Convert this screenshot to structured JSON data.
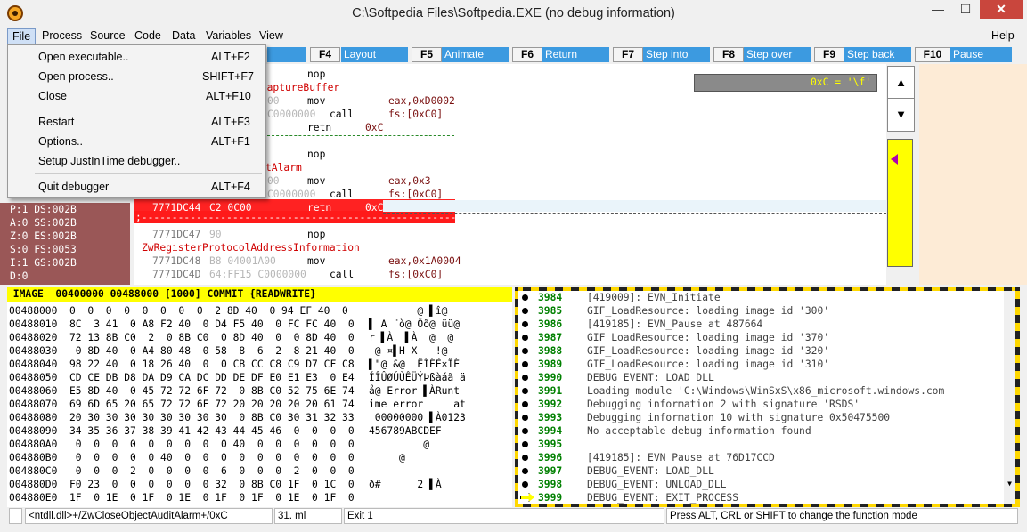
{
  "window": {
    "title": "C:\\Softpedia Files\\Softpedia.EXE (no debug information)",
    "min": "—",
    "max": "☐",
    "close": "✕"
  },
  "menubar": {
    "items": [
      "File",
      "Process",
      "Source",
      "Code",
      "Data",
      "Variables",
      "View"
    ],
    "help": "Help"
  },
  "fkeys": [
    {
      "key": "F4",
      "label": "Layout"
    },
    {
      "key": "F5",
      "label": "Animate"
    },
    {
      "key": "F6",
      "label": "Return"
    },
    {
      "key": "F7",
      "label": "Step into"
    },
    {
      "key": "F8",
      "label": "Step over"
    },
    {
      "key": "F9",
      "label": "Step back"
    },
    {
      "key": "F10",
      "label": "Pause"
    }
  ],
  "file_menu": {
    "items": [
      {
        "label": "Open executable..",
        "shortcut": "ALT+F2"
      },
      {
        "label": "Open process..",
        "shortcut": "SHIFT+F7"
      },
      {
        "label": "Close",
        "shortcut": "ALT+F10"
      },
      {
        "label": "Restart",
        "shortcut": "ALT+F3"
      },
      {
        "label": "Options..",
        "shortcut": "ALT+F1"
      },
      {
        "label": "Setup JustInTime debugger..",
        "shortcut": ""
      },
      {
        "label": "Quit debugger",
        "shortcut": "ALT+F4"
      }
    ]
  },
  "code": {
    "watch": "0xC = '\\f'",
    "lines": [
      {
        "addr": "",
        "bytes": "",
        "mn": "nop",
        "op": "",
        "lbl": ""
      },
      {
        "addr": "",
        "bytes": "",
        "mn": "",
        "op": "",
        "lbl": "eCaptureBuffer"
      },
      {
        "addr": "",
        "bytes": "00",
        "mn": "mov",
        "op": "eax,0xD0002",
        "lbl": ""
      },
      {
        "addr": "",
        "bytes": "C0000000",
        "mn": "call",
        "op": "fs:[0xC0]",
        "lbl": ""
      },
      {
        "addr": "",
        "bytes": "",
        "mn": "retn",
        "op": "0xC",
        "lbl": ""
      },
      {
        "addr": "",
        "bytes": "",
        "mn": "",
        "op": "",
        "lbl": ""
      },
      {
        "addr": "",
        "bytes": "",
        "mn": "nop",
        "op": "",
        "lbl": ""
      },
      {
        "addr": "",
        "bytes": "",
        "mn": "",
        "op": "",
        "lbl": "tAlarm"
      },
      {
        "addr": "",
        "bytes": "00",
        "mn": "mov",
        "op": "eax,0x3",
        "lbl": ""
      },
      {
        "addr": "",
        "bytes": "C0000000",
        "mn": "call",
        "op": "fs:[0xC0]",
        "lbl": ""
      },
      {
        "addr": "7771DC44",
        "bytes": "C2 0C00",
        "mn": "retn",
        "op": "0xC",
        "lbl": ""
      },
      {
        "addr": "",
        "bytes": "",
        "mn": "",
        "op": "",
        "lbl": ""
      },
      {
        "addr": "7771DC47",
        "bytes": "90",
        "mn": "nop",
        "op": "",
        "lbl": ""
      },
      {
        "addr": "",
        "bytes": "",
        "mn": "",
        "op": "",
        "lbl": "ZwRegisterProtocolAddressInformation"
      },
      {
        "addr": "7771DC48",
        "bytes": "B8 04001A00",
        "mn": "mov",
        "op": "eax,0x1A0004",
        "lbl": ""
      },
      {
        "addr": "7771DC4D",
        "bytes": "64:FF15 C0000000",
        "mn": "call",
        "op": "fs:[0xC0]",
        "lbl": ""
      }
    ],
    "dashes": ";-----------------------------------------------------"
  },
  "registers": [
    "P:1 DS:002B",
    "A:0 SS:002B",
    "Z:0 ES:002B",
    "S:0 FS:0053",
    "I:1 GS:002B",
    "D:0"
  ],
  "memory": {
    "header": " IMAGE  00400000 00488000 [1000] COMMIT {READWRITE}",
    "rows": [
      {
        "a": "00488000",
        "h": "0  0  0  0  0  0  0  0  2 8D 40  0 94 EF 40  0",
        "t": "        @ ▌î@"
      },
      {
        "a": "00488010",
        "h": "8C  3 41  0 A8 F2 40  0 D4 F5 40  0 FC FC 40  0",
        "t": "▌ A ¨ò@ Ôõ@ üü@"
      },
      {
        "a": "00488020",
        "h": "72 13 8B C0  2  0 8B C0  0 8D 40  0  0 8D 40  0",
        "t": "r ▌À  ▌À  @  @"
      },
      {
        "a": "00488030",
        "h": " 0 8D 40  0 A4 80 48  0 58  8  6  2  8 21 40  0",
        "t": " @ ¤▌H X   !@"
      },
      {
        "a": "00488040",
        "h": "98 22 40  0 18 26 40  0  0 CB CC C8 C9 D7 CF C8",
        "t": "▌\"@ &@  ËÌÈÉ×ÏÈ"
      },
      {
        "a": "00488050",
        "h": "CD CE DB D8 DA D9 CA DC DD DE DF E0 E1 E3  0 E4",
        "t": "ÍÎÛØÚÙÊÜÝÞßàáã ä"
      },
      {
        "a": "00488060",
        "h": "E5 8D 40  0 45 72 72 6F 72  0 8B C0 52 75 6E 74",
        "t": "å@ Error ▌ÀRunt"
      },
      {
        "a": "00488070",
        "h": "69 6D 65 20 65 72 72 6F 72 20 20 20 20 20 61 74",
        "t": "ime error     at"
      },
      {
        "a": "00488080",
        "h": "20 30 30 30 30 30 30 30 30  0 8B C0 30 31 32 33",
        "t": " 00000000 ▌À0123"
      },
      {
        "a": "00488090",
        "h": "34 35 36 37 38 39 41 42 43 44 45 46  0  0  0  0",
        "t": "456789ABCDEF"
      },
      {
        "a": "004880A0",
        "h": " 0  0  0  0  0  0  0  0  0 40  0  0  0  0  0  0",
        "t": "         @"
      },
      {
        "a": "004880B0",
        "h": " 0  0  0  0  0 40  0  0  0  0  0  0  0  0  0  0",
        "t": "     @"
      },
      {
        "a": "004880C0",
        "h": " 0  0  0  2  0  0  0  0  6  0  0  0  2  0  0  0",
        "t": ""
      },
      {
        "a": "004880D0",
        "h": "F0 23  0  0  0  0  0  0 32  0 8B C0 1F  0 1C  0",
        "t": "ð#      2 ▌À"
      },
      {
        "a": "004880E0",
        "h": "1F  0 1E  0 1F  0 1E  0 1F  0 1F  0 1E  0 1F  0",
        "t": ""
      }
    ]
  },
  "log": [
    {
      "n": "3984",
      "text": "[419009]: EVN_Initiate"
    },
    {
      "n": "3985",
      "text": "GIF_LoadResource: loading image id '300'"
    },
    {
      "n": "3986",
      "text": "[419185]: EVN_Pause at 487664"
    },
    {
      "n": "3987",
      "text": "GIF_LoadResource: loading image id '370'"
    },
    {
      "n": "3988",
      "text": "GIF_LoadResource: loading image id '320'"
    },
    {
      "n": "3989",
      "text": "GIF_LoadResource: loading image id '310'"
    },
    {
      "n": "3990",
      "text": "DEBUG_EVENT: LOAD_DLL"
    },
    {
      "n": "3991",
      "text": "Loading module 'C:\\Windows\\WinSxS\\x86_microsoft.windows.com"
    },
    {
      "n": "3992",
      "text": "Debugging information 2 with signature 'RSDS'"
    },
    {
      "n": "3993",
      "text": "Debugging information 10 with signature 0x50475500"
    },
    {
      "n": "3994",
      "text": "No acceptable debug information found"
    },
    {
      "n": "3995",
      "text": ""
    },
    {
      "n": "3996",
      "text": "[419185]: EVN_Pause at 76D17CCD"
    },
    {
      "n": "3997",
      "text": "DEBUG_EVENT: LOAD_DLL"
    },
    {
      "n": "3998",
      "text": "DEBUG_EVENT: UNLOAD_DLL"
    },
    {
      "n": "3999",
      "text": "DEBUG_EVENT: EXIT_PROCESS"
    }
  ],
  "status": {
    "location": "<ntdll.dll>+/ZwCloseObjectAuditAlarm+/0xC",
    "mode": "31. ml",
    "exit": "Exit 1",
    "hint": "Press ALT, CRL or SHIFT to change the function mode"
  },
  "colors": {
    "accent": "#3c9ae0",
    "current_line": "#ff2222",
    "registers_bg": "#9a5757",
    "memory_header": "#ffff00"
  }
}
